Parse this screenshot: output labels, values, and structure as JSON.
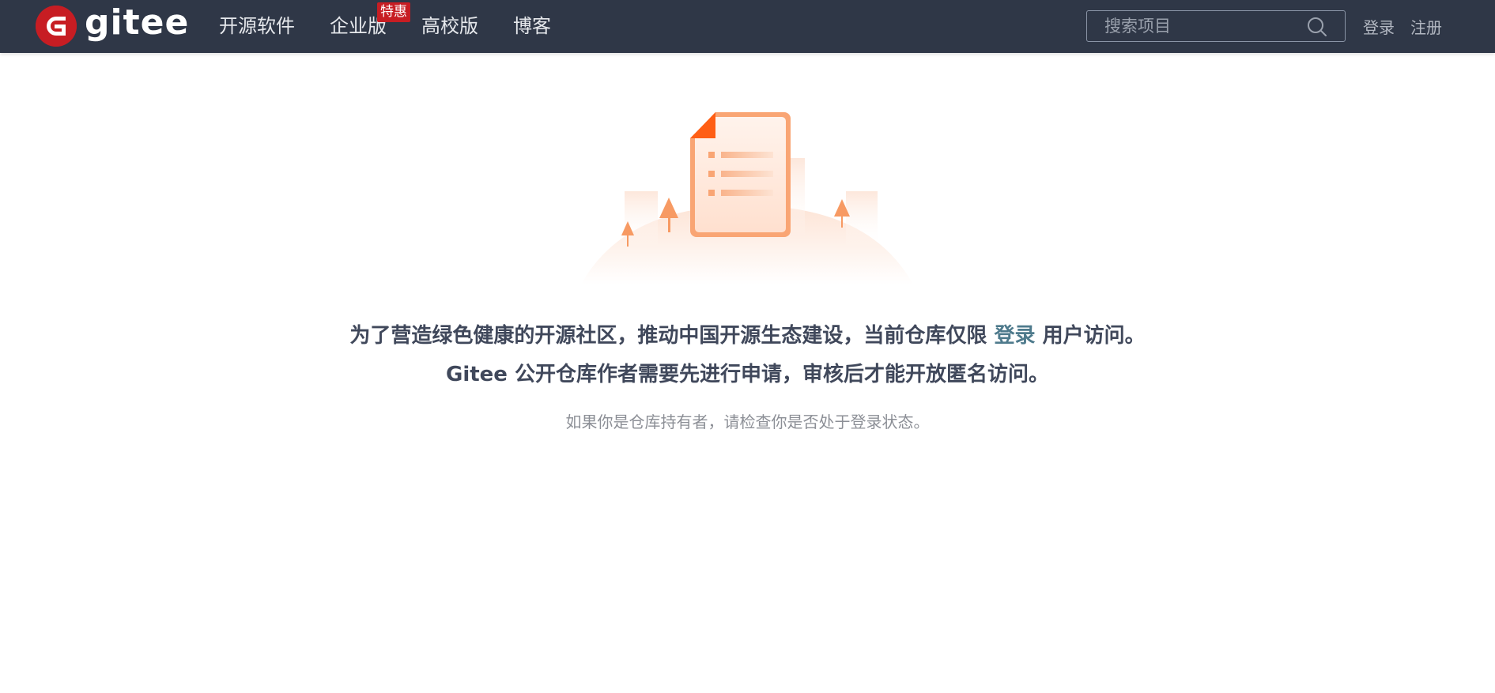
{
  "header": {
    "logo_text": "gitee",
    "nav": [
      {
        "label": "开源软件"
      },
      {
        "label": "企业版",
        "badge": "特惠"
      },
      {
        "label": "高校版"
      },
      {
        "label": "博客"
      }
    ],
    "search": {
      "placeholder": "搜索项目"
    },
    "login_label": "登录",
    "register_label": "注册"
  },
  "notice": {
    "line1_before": "为了营造绿色健康的开源社区，推动中国开源生态建设，当前仓库仅限",
    "line1_link": "登录",
    "line1_after": "用户访问。",
    "line2": "Gitee 公开仓库作者需要先进行申请，审核后才能开放匿名访问。",
    "hint": "如果你是仓库持有者，请检查你是否处于登录状态。"
  },
  "colors": {
    "header_bg": "#2f3747",
    "brand_red": "#c71d23",
    "link": "#4e7a8c",
    "illustration_orange": "#f68b4e"
  }
}
